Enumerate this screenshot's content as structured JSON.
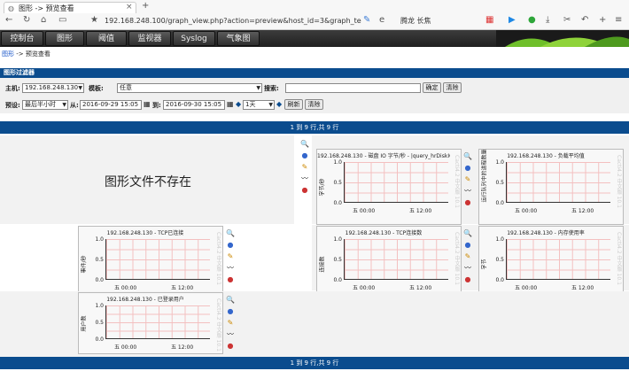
{
  "browser": {
    "tab_title": "图形 -> 预览查看",
    "address": "192.168.248.100/graph_view.php?action=preview&host_id=3&graph_templa",
    "user": "腾龙 长焦"
  },
  "nav": {
    "items": [
      "控制台",
      "图形",
      "阈值",
      "监视器",
      "Syslog",
      "气象图"
    ]
  },
  "breadcrumb": {
    "link": "图形",
    "sep": "->",
    "current": "预览查看"
  },
  "filter": {
    "header": "图形过滤器",
    "host_label": "主机:",
    "host_value": "192.168.248.130",
    "template_label": "模板:",
    "template_value": "任意",
    "search_label": "搜索:",
    "search_value": "",
    "apply": "确定",
    "clear": "清除",
    "preset_label": "预设:",
    "preset_value": "最后半小时",
    "from_label": "从:",
    "from_value": "2016-09-29 15:05",
    "to_label": "到:",
    "to_value": "2016-09-30 15:05",
    "span_value": "1天",
    "refresh": "刷新",
    "clear2": "清除"
  },
  "pager": {
    "text": "1 到 9 行,共 9 行"
  },
  "missing": "图形文件不存在",
  "watermark": "Cacti4.2 中文版 10.1",
  "graphs": [
    {
      "title": "192.168.248.130 - 磁盘 IO 字节/秒 - |query_hrDiskIODesc|",
      "ylabel": "字节/秒",
      "yticks": [
        "1.0",
        "0.5",
        "0.0"
      ],
      "xticks": [
        "五 00:00",
        "五 12:00"
      ]
    },
    {
      "title": "192.168.248.130 - 负载平均值",
      "ylabel": "运行队列中的进程数量",
      "yticks": [
        "1.0",
        "0.5",
        "0.0"
      ],
      "xticks": [
        "五 00:00",
        "五 12:00"
      ]
    },
    {
      "title": "192.168.248.130 - TCP已连接",
      "ylabel": "事件/秒",
      "yticks": [
        "1.0",
        "0.5",
        "0.0"
      ],
      "xticks": [
        "五 00:00",
        "五 12:00"
      ]
    },
    {
      "title": "192.168.248.130 - TCP连接数",
      "ylabel": "连接数",
      "yticks": [
        "1.0",
        "0.5",
        "0.0"
      ],
      "xticks": [
        "五 00:00",
        "五 12:00"
      ]
    },
    {
      "title": "192.168.248.130 - 内存使用率",
      "ylabel": "字节",
      "yticks": [
        "1.0",
        "0.5",
        "0.0"
      ],
      "xticks": [
        "五 00:00",
        "五 12:00"
      ]
    },
    {
      "title": "192.168.248.130 - 已登录用户",
      "ylabel": "用户数",
      "yticks": [
        "1.0",
        "0.5",
        "0.0"
      ],
      "xticks": [
        "五 00:00",
        "五 12:00"
      ]
    }
  ]
}
